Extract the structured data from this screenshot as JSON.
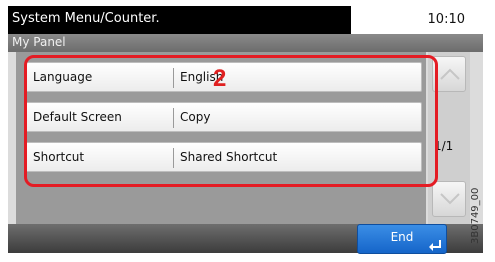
{
  "header": {
    "title": "System Menu/Counter.",
    "time": "10:10",
    "subtitle": "My Panel"
  },
  "settings": [
    {
      "label": "Language",
      "value": "English"
    },
    {
      "label": "Default Screen",
      "value": "Copy"
    },
    {
      "label": "Shortcut",
      "value": "Shared Shortcut"
    }
  ],
  "callout": "2",
  "pagination": {
    "indicator": "1/1"
  },
  "footer": {
    "end_label": "End"
  },
  "figure_code": "3B0749_00",
  "icons": {
    "scroll_up": "chevron-up-icon",
    "scroll_down": "chevron-down-icon",
    "enter": "enter-icon"
  },
  "colors": {
    "highlight": "#e41c24",
    "end_button": "#1a6fd6",
    "callout": "#e02020"
  }
}
